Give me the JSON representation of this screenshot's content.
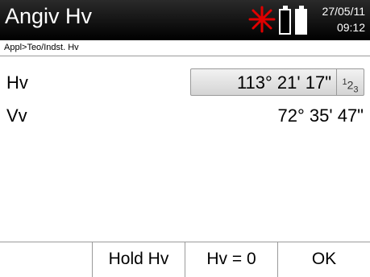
{
  "header": {
    "title": "Angiv Hv",
    "date": "27/05/11",
    "time": "09:12",
    "laser_icon": "laser-icon",
    "battery_icons": [
      "battery-empty-icon",
      "battery-full-icon"
    ]
  },
  "breadcrumb": "Appl>Teo/Indst. Hv",
  "fields": {
    "hv": {
      "label": "Hv",
      "value": "113° 21' 17\"",
      "mode": "123"
    },
    "vv": {
      "label": "Vv",
      "value": "72° 35' 47\""
    }
  },
  "softkeys": [
    "",
    "Hold Hv",
    "Hv = 0",
    "OK"
  ],
  "colors": {
    "titlebar": "#000000",
    "laser": "#e00000"
  }
}
